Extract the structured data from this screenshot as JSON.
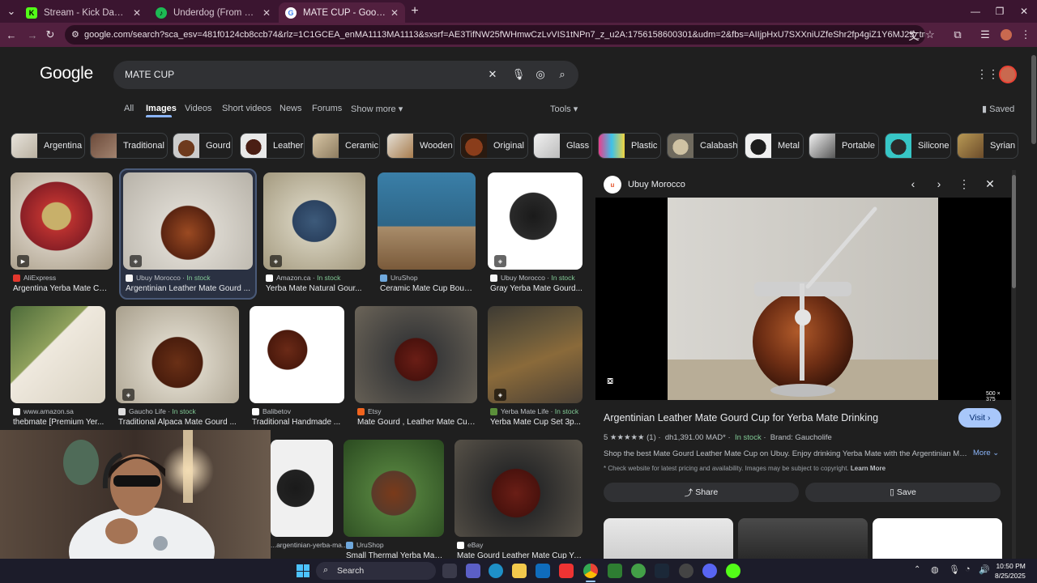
{
  "tabs": [
    {
      "title": "Stream - Kick Dashboard",
      "favicon": "K"
    },
    {
      "title": "Underdog (From F1® The Mov",
      "favicon": "music"
    },
    {
      "title": "MATE CUP - Google Search",
      "favicon": "G"
    }
  ],
  "address_bar": {
    "url": "google.com/search?sca_esv=481f0124cb8ccb74&rlz=1C1GCEA_enMA1113MA1113&sxsrf=AE3TifNW25fWHmwCzLvVIS1tNPn7_z_u2A:1756158600301&udm=2&fbs=AIIjpHxU7SXXniUZfeShr2fp4giZ1Y6MJ25_tmWITc7uy4KleoJTKjrFjVxydQWqI2..."
  },
  "search": {
    "logo": "Google",
    "query": "MATE CUP"
  },
  "nav": {
    "tabs": [
      "All",
      "Images",
      "Videos",
      "Short videos",
      "News",
      "Forums",
      "Show more"
    ],
    "tools": "Tools",
    "saved": "Saved"
  },
  "chips": [
    "Argentina",
    "Traditional",
    "Gourd",
    "Leather",
    "Ceramic",
    "Wooden",
    "Original",
    "Glass",
    "Plastic",
    "Calabash",
    "Metal",
    "Portable",
    "Silicone",
    "Syrian"
  ],
  "results": [
    {
      "source": "AliExpress",
      "stock": "",
      "title": "Argentina Yerba Mate Cu..."
    },
    {
      "source": "Ubuy Morocco",
      "stock": "In stock",
      "title": "Argentinian Leather Mate Gourd ..."
    },
    {
      "source": "Amazon.ca",
      "stock": "In stock",
      "title": "Yerba Mate Natural Gour..."
    },
    {
      "source": "UruShop",
      "stock": "",
      "title": "Ceramic Mate Cup Bound..."
    },
    {
      "source": "Ubuy Morocco",
      "stock": "In stock",
      "title": "Gray Yerba Mate Gourd..."
    },
    {
      "source": "www.amazon.sa",
      "stock": "",
      "title": "thebmate [Premium Yer..."
    },
    {
      "source": "Gaucho Life",
      "stock": "In stock",
      "title": "Traditional Alpaca Mate Gourd ..."
    },
    {
      "source": "Balibetov",
      "stock": "",
      "title": "Traditional Handmade ..."
    },
    {
      "source": "Etsy",
      "stock": "",
      "title": "Mate Gourd , Leather Mate Cup..."
    },
    {
      "source": "Yerba Mate Life",
      "stock": "In stock",
      "title": "Yerba Mate Cup Set 3p..."
    },
    {
      "source": "...argentinian-yerba-ma...",
      "stock": "",
      "title": ""
    },
    {
      "source": "UruShop",
      "stock": "",
      "title": "Small Thermal Yerba Mat..."
    },
    {
      "source": "eBay",
      "stock": "",
      "title": "Mate Gourd Leather Mate Cup Ye..."
    }
  ],
  "preview": {
    "site": "Ubuy Morocco",
    "site_logo": "u",
    "dimensions": "500 × 375",
    "title": "Argentinian Leather Mate Gourd Cup for Yerba Mate Drinking",
    "visit": "Visit",
    "rating": "5 ★★★★★ (1)",
    "price": "dh1,391.00 MAD*",
    "stock": "In stock",
    "brand": "Brand: Gaucholife",
    "description": "Shop the best Mate Gourd Leather Mate Cup on Ubuy. Enjoy drinking Yerba Mate with the Argentinian Mate...",
    "more": "More",
    "note": "* Check website for latest pricing and availability. Images may be subject to copyright.",
    "learn_more": "Learn More",
    "share": "Share",
    "save": "Save"
  },
  "taskbar": {
    "search": "Search",
    "time": "10:50 PM",
    "date": "8/25/2025"
  },
  "colors": {
    "tabstrip": "#3b1530",
    "toolbar": "#52203f",
    "page_bg": "#1f1f1f",
    "accent": "#8ab4f8",
    "in_stock": "#81c995"
  }
}
